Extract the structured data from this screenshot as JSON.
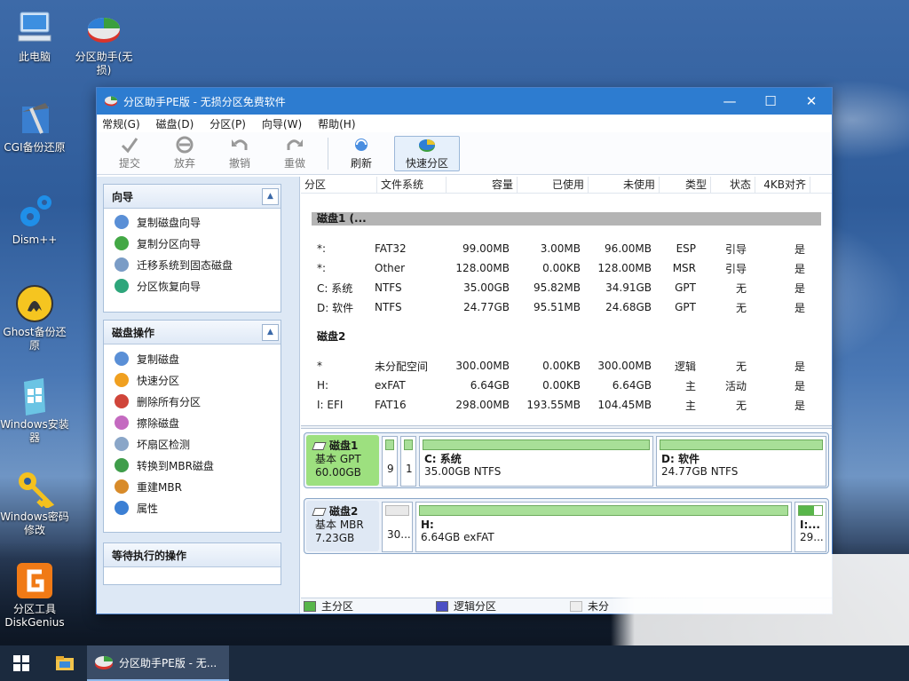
{
  "desktop": {
    "icons": [
      {
        "label": "此电脑",
        "icon": "computer-icon"
      },
      {
        "label": "分区助手(无损)",
        "icon": "partition-assistant-icon"
      },
      {
        "label": "CGI备份还原",
        "icon": "cgi-backup-icon"
      },
      {
        "label": "Dism++",
        "icon": "dism-gear-icon"
      },
      {
        "label": "Ghost备份还原",
        "icon": "ghost-icon"
      },
      {
        "label": "Windows安装器",
        "icon": "windows-installer-icon"
      },
      {
        "label": "Windows密码修改",
        "icon": "key-icon"
      },
      {
        "label": "分区工具DiskGenius",
        "icon": "diskgenius-icon"
      }
    ]
  },
  "window": {
    "title": "分区助手PE版 - 无损分区免费软件",
    "min": "—",
    "max": "☐",
    "close": "✕"
  },
  "menu": [
    "常规(G)",
    "磁盘(D)",
    "分区(P)",
    "向导(W)",
    "帮助(H)"
  ],
  "toolbar": {
    "commit": "提交",
    "discard": "放弃",
    "undo": "撤销",
    "redo": "重做",
    "refresh": "刷新",
    "quick": "快速分区"
  },
  "wizard": {
    "title": "向导",
    "items": [
      "复制磁盘向导",
      "复制分区向导",
      "迁移系统到固态磁盘",
      "分区恢复向导"
    ]
  },
  "diskops": {
    "title": "磁盘操作",
    "items": [
      "复制磁盘",
      "快速分区",
      "删除所有分区",
      "擦除磁盘",
      "坏扇区检测",
      "转换到MBR磁盘",
      "重建MBR",
      "属性"
    ]
  },
  "pending": {
    "title": "等待执行的操作"
  },
  "table": {
    "headers": [
      "分区",
      "文件系统",
      "容量",
      "已使用",
      "未使用",
      "类型",
      "状态",
      "4KB对齐"
    ],
    "disk1": {
      "label": "磁盘1 (...",
      "rows": [
        [
          "*:",
          "FAT32",
          "99.00MB",
          "3.00MB",
          "96.00MB",
          "ESP",
          "引导",
          "是"
        ],
        [
          "*:",
          "Other",
          "128.00MB",
          "0.00KB",
          "128.00MB",
          "MSR",
          "引导",
          "是"
        ],
        [
          "C: 系统",
          "NTFS",
          "35.00GB",
          "95.82MB",
          "34.91GB",
          "GPT",
          "无",
          "是"
        ],
        [
          "D: 软件",
          "NTFS",
          "24.77GB",
          "95.51MB",
          "24.68GB",
          "GPT",
          "无",
          "是"
        ]
      ]
    },
    "disk2": {
      "label": "磁盘2",
      "rows": [
        [
          "*",
          "未分配空间",
          "300.00MB",
          "0.00KB",
          "300.00MB",
          "逻辑",
          "无",
          "是"
        ],
        [
          "H:",
          "exFAT",
          "6.64GB",
          "0.00KB",
          "6.64GB",
          "主",
          "活动",
          "是"
        ],
        [
          "I: EFI",
          "FAT16",
          "298.00MB",
          "193.55MB",
          "104.45MB",
          "主",
          "无",
          "是"
        ]
      ]
    }
  },
  "map": {
    "disk1": {
      "name": "磁盘1",
      "type": "基本 GPT",
      "size": "60.00GB",
      "p1": "9",
      "p2": "1",
      "c_name": "C: 系统",
      "c_info": "35.00GB NTFS",
      "d_name": "D: 软件",
      "d_info": "24.77GB NTFS"
    },
    "disk2": {
      "name": "磁盘2",
      "type": "基本 MBR",
      "size": "7.23GB",
      "u": "30...",
      "h_name": "H:",
      "h_info": "6.64GB exFAT",
      "i_name": "I:...",
      "i_info": "29..."
    }
  },
  "legend": {
    "primary": "主分区",
    "logical": "逻辑分区",
    "unalloc": "未分"
  },
  "taskbar": {
    "app": "分区助手PE版 - 无..."
  },
  "colors": {
    "titlebar": "#2d7cd0",
    "primary": "#a8df98",
    "selected": "#9de07f"
  }
}
